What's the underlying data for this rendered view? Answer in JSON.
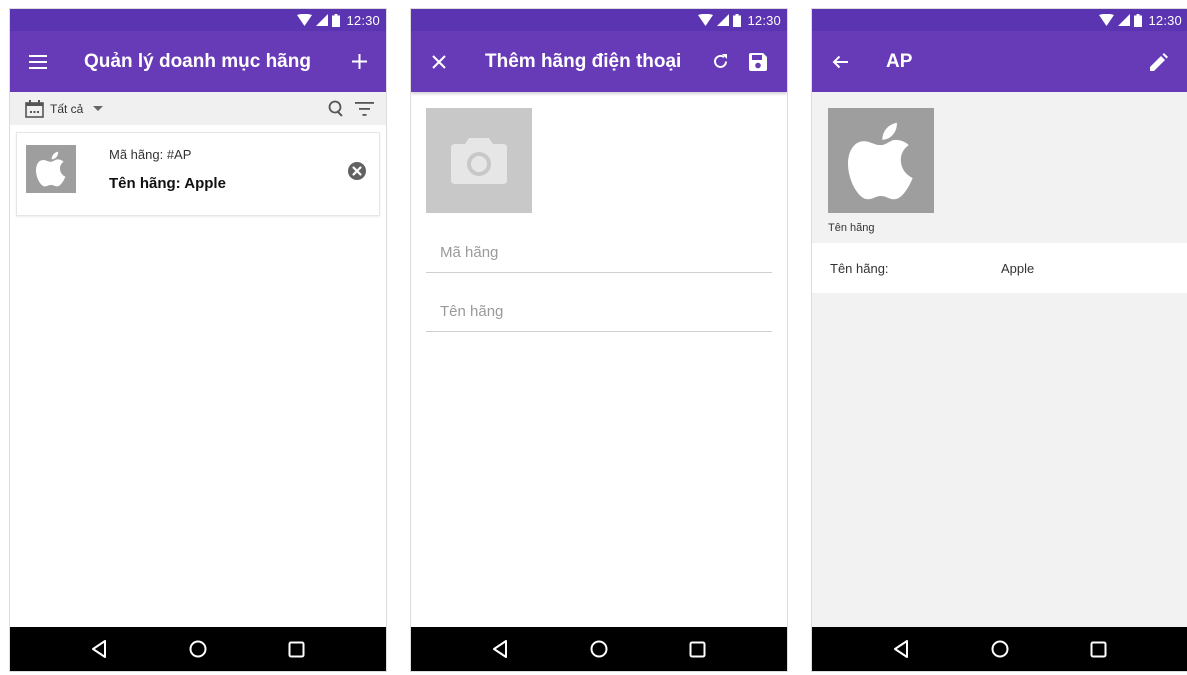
{
  "status_bar": {
    "time": "12:30"
  },
  "screen_list": {
    "title": "Quản lý doanh mục hãng",
    "filter_label": "Tất cả",
    "items": [
      {
        "code_label": "Mã hãng: #AP",
        "name_label": "Tên hãng: Apple"
      }
    ]
  },
  "screen_add": {
    "title": "Thêm hãng điện thoại",
    "code_placeholder": "Mã hãng",
    "name_placeholder": "Tên hãng"
  },
  "screen_detail": {
    "title": "AP",
    "image_caption": "Tên hãng",
    "name_label": "Tên hãng:",
    "name_value": "Apple"
  },
  "colors": {
    "app_bar": "#673ab7",
    "status_bar": "#5b34b2",
    "nav_bar": "#000000"
  }
}
